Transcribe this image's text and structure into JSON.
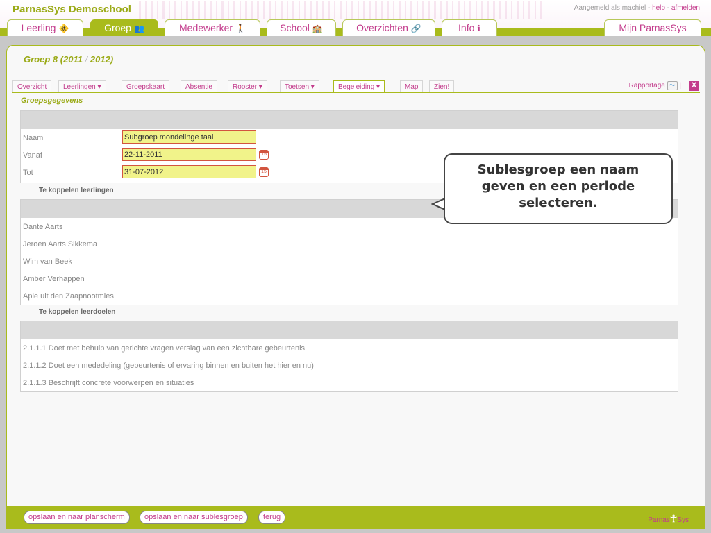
{
  "header": {
    "brand": "ParnasSys Demoschool",
    "login_prefix": "Aangemeld als machiel - ",
    "help": "help",
    "sep": " - ",
    "logout": "afmelden"
  },
  "nav": {
    "tabs": [
      {
        "label": "Leerling",
        "icon": "🚸"
      },
      {
        "label": "Groep",
        "icon": "👥"
      },
      {
        "label": "Medewerker",
        "icon": "🚶"
      },
      {
        "label": "School",
        "icon": "🏫"
      },
      {
        "label": "Overzichten",
        "icon": "🔗"
      },
      {
        "label": "Info",
        "icon": "ℹ"
      }
    ],
    "right_tab": "Mijn ParnasSys"
  },
  "groep": {
    "name": "Groep 8 (2011",
    "slash": "/",
    "year_end": "2012)"
  },
  "subtabs": [
    "Overzicht",
    "Leerlingen ▾",
    "Groepskaart",
    "Absentie",
    "Rooster ▾",
    "Toetsen ▾",
    "Begeleiding ▾",
    "Map",
    "Zien!"
  ],
  "rapportage": {
    "label": "Rapportage",
    "sep": "|",
    "close": "X"
  },
  "section_title": "Groepsgegevens",
  "form": {
    "naam_label": "Naam",
    "naam_value": "Subgroep mondelinge taal",
    "vanaf_label": "Vanaf",
    "vanaf_value": "22-11-2011",
    "tot_label": "Tot",
    "tot_value": "31-07-2012",
    "cal_text": "15"
  },
  "leerlingen": {
    "title": "Te koppelen leerlingen",
    "items": [
      "Dante Aarts",
      "Jeroen Aarts Sikkema",
      "Wim van Beek",
      "Amber Verhappen",
      "Apie uit den Zaapnootmies"
    ]
  },
  "leerdoelen": {
    "title": "Te koppelen leerdoelen",
    "items": [
      "2.1.1.1 Doet met behulp van gerichte vragen verslag van een zichtbare gebeurtenis",
      "2.1.1.2 Doet een mededeling (gebeurtenis of ervaring binnen en buiten het hier en nu)",
      "2.1.1.3 Beschrijft concrete voorwerpen en situaties"
    ]
  },
  "callout": "Sublesgroep een naam geven en een periode selecteren.",
  "footer": {
    "btn_plan": "opslaan en naar planscherm",
    "btn_sub": "opslaan en naar sublesgroep",
    "btn_back": "terug",
    "logo_left": "Parnas",
    "logo_right": "Sys"
  }
}
